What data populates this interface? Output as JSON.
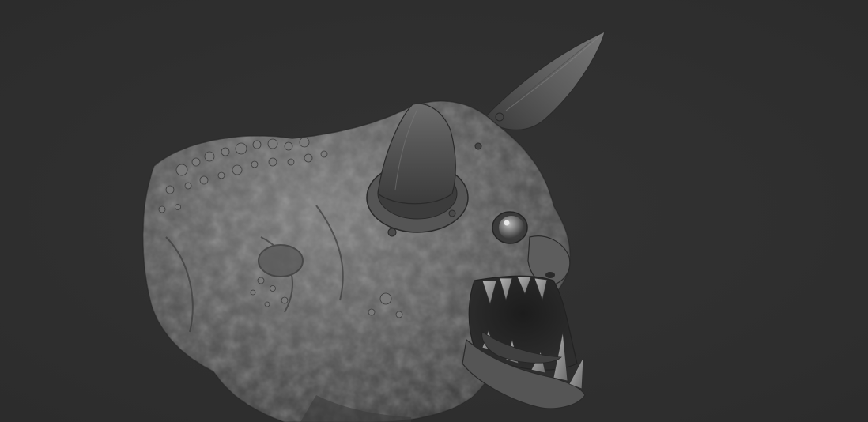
{
  "viewport": {
    "background_color": "#2f2f2f"
  },
  "model": {
    "subject": "creature-head-sculpt",
    "material_color": "#6b6b6b",
    "shadow_color": "#1e1e1e",
    "highlight_color": "#9a9a9a"
  }
}
